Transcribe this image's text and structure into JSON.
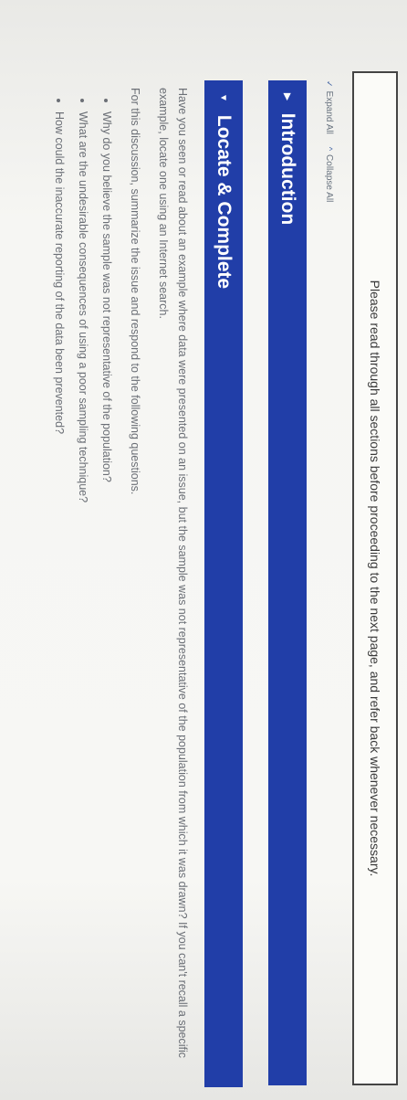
{
  "notice": "Please read through all sections before proceeding to the next page, and refer back whenever necessary.",
  "controls": {
    "expand_label": "Expand All",
    "collapse_label": "Collapse All"
  },
  "sections": [
    {
      "title": "Introduction",
      "expanded": false
    },
    {
      "title": "Locate & Complete",
      "expanded": true
    }
  ],
  "content": {
    "paragraph1": "Have you seen or read about an example where data were presented on an issue, but the sample was not representative of the population from which it was drawn? If you can't recall a specific example, locate one using an Internet search.",
    "paragraph2": "For this discussion, summarize the issue and respond to the following questions.",
    "questions": [
      "Why do you believe the sample was not representative of the population?",
      "What are the undesirable consequences of using a poor sampling technique?",
      "How could the inaccurate reporting of the data been prevented?"
    ]
  },
  "colors": {
    "panel_header": "#213ea8",
    "body_text": "#6b6f76"
  }
}
